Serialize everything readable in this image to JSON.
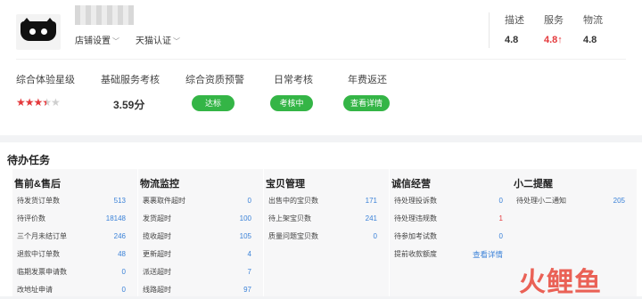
{
  "shop": {
    "settings_label": "店铺设置",
    "cert_label": "天猫认证"
  },
  "dsr": [
    {
      "label": "描述",
      "value": "4.8"
    },
    {
      "label": "服务",
      "value": "4.8↑"
    },
    {
      "label": "物流",
      "value": "4.8"
    }
  ],
  "metrics": {
    "experience_label": "综合体验星级",
    "experience_stars": 3.5,
    "stars_on": "★★★",
    "stars_half": "★",
    "stars_off": "★",
    "basic_label": "基础服务考核",
    "basic_score": "3.59分",
    "qualification_label": "综合资质预警",
    "qualification_status": "达标",
    "daily_label": "日常考核",
    "daily_status": "考核中",
    "annual_label": "年费返还",
    "annual_status": "查看详情"
  },
  "todo": {
    "title": "待办任务",
    "panels": [
      {
        "title": "售前&售后",
        "rows": [
          {
            "label": "待发货订单数",
            "value": "513"
          },
          {
            "label": "待评价数",
            "value": "18148"
          },
          {
            "label": "三个月未结订单",
            "value": "246"
          },
          {
            "label": "退款中订单数",
            "value": "48"
          },
          {
            "label": "临期发票申请数",
            "value": "0"
          },
          {
            "label": "改地址申请",
            "value": "0"
          }
        ]
      },
      {
        "title": "物流监控",
        "rows": [
          {
            "label": "裹裹取件超时",
            "value": "0"
          },
          {
            "label": "发货超时",
            "value": "100"
          },
          {
            "label": "揽收超时",
            "value": "105"
          },
          {
            "label": "更新超时",
            "value": "4"
          },
          {
            "label": "派送超时",
            "value": "7"
          },
          {
            "label": "线路超时",
            "value": "97"
          }
        ]
      },
      {
        "title": "宝贝管理",
        "rows": [
          {
            "label": "出售中的宝贝数",
            "value": "171"
          },
          {
            "label": "待上架宝贝数",
            "value": "241"
          },
          {
            "label": "质量问题宝贝数",
            "value": "0"
          }
        ]
      },
      {
        "title": "诚信经营",
        "rows": [
          {
            "label": "待处理投诉数",
            "value": "0"
          },
          {
            "label": "待处理违规数",
            "value": "1"
          },
          {
            "label": "待参加考试数",
            "value": "0"
          },
          {
            "label": "提前收款额度",
            "value": "查看详情"
          }
        ]
      },
      {
        "title": "小二提醒",
        "rows": [
          {
            "label": "待处理小二通知",
            "value": "205"
          }
        ]
      }
    ]
  },
  "watermark": "火鲤鱼",
  "colors": {
    "accent_red": "#e4393c",
    "pill_green": "#34b546",
    "link_blue": "#3b82d8",
    "highlight": "#f5a623"
  }
}
